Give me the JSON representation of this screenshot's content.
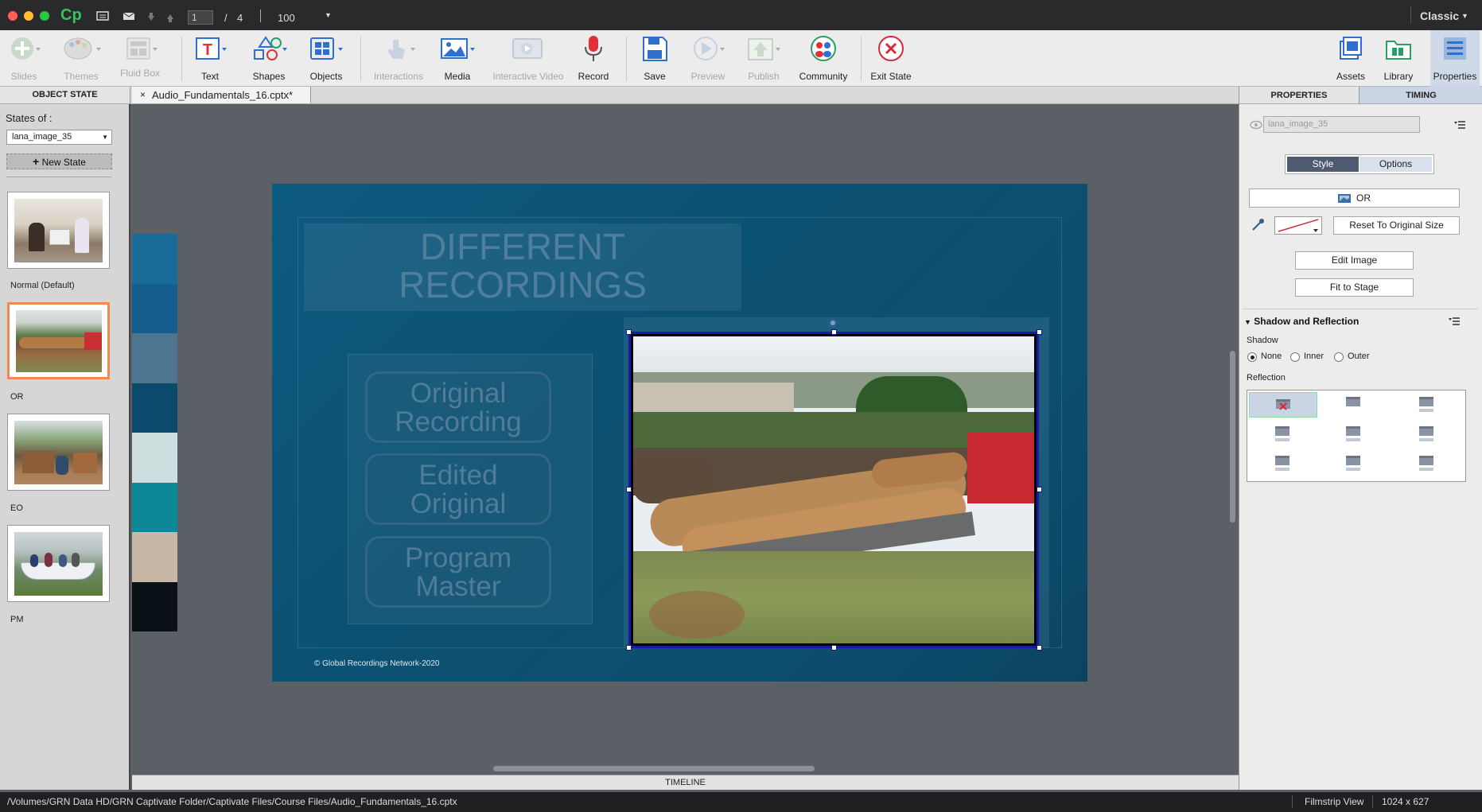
{
  "app": {
    "logo": "Cp",
    "page_current": "1",
    "page_sep": "/",
    "page_total": "4",
    "zoom": "100",
    "workspace": "Classic"
  },
  "toolbar": {
    "slides": "Slides",
    "themes": "Themes",
    "fluid_box": "Fluid Box",
    "text": "Text",
    "shapes": "Shapes",
    "objects": "Objects",
    "interactions": "Interactions",
    "media": "Media",
    "interactive_video": "Interactive Video",
    "record": "Record",
    "save": "Save",
    "preview": "Preview",
    "publish": "Publish",
    "community": "Community",
    "exit_state": "Exit State",
    "assets": "Assets",
    "library": "Library",
    "properties": "Properties"
  },
  "tabs": {
    "object_state": "OBJECT STATE",
    "doc_close": "×",
    "doc": "Audio_Fundamentals_16.cptx*",
    "properties": "PROPERTIES",
    "timing": "TIMING"
  },
  "states": {
    "label": "States of :",
    "selected_object": "lana_image_35",
    "new_state": "New State",
    "items": [
      {
        "label": "Normal (Default)"
      },
      {
        "label": "OR"
      },
      {
        "label": "EO"
      },
      {
        "label": "PM"
      }
    ]
  },
  "slide": {
    "title_line1": "DIFFERENT",
    "title_line2": "RECORDINGS",
    "btn1_l1": "Original",
    "btn1_l2": "Recording",
    "btn2_l1": "Edited",
    "btn2_l2": "Original",
    "btn3_l1": "Program",
    "btn3_l2": "Master",
    "copyright": "© Global Recordings Network-2020"
  },
  "swatches": [
    "#1a6a9a",
    "#135e8e",
    "#4d7590",
    "#0b4a6c",
    "#cfdedf",
    "#0e8898",
    "#c7b8a6",
    "#0a1218"
  ],
  "props": {
    "name": "lana_image_35",
    "style_tab": "Style",
    "options_tab": "Options",
    "state_name": "OR",
    "reset_size": "Reset To Original Size",
    "edit_image": "Edit Image",
    "fit_stage": "Fit to Stage",
    "shadow_reflection": "Shadow and Reflection",
    "shadow": "Shadow",
    "shadow_none": "None",
    "shadow_inner": "Inner",
    "shadow_outer": "Outer",
    "reflection": "Reflection",
    "shadow_selected": "None"
  },
  "timeline": "TIMELINE",
  "status": {
    "path": "/Volumes/GRN Data HD/GRN Captivate Folder/Captivate Files/Course Files/Audio_Fundamentals_16.cptx",
    "view": "Filmstrip View",
    "size": "1024 x 627"
  },
  "colors": {
    "accent": "#2e7bd6",
    "selected_thumb": "#f28a50",
    "record_red": "#e0303a",
    "exit_red": "#d8283a",
    "shapes_blue": "#2f6fd0",
    "toolbar_bg": "#ececec",
    "slide_bg": "#0d5275"
  },
  "icons": [
    "add-slide-icon",
    "themes-icon",
    "fluid-box-icon",
    "text-icon",
    "shapes-icon",
    "objects-icon",
    "interactions-icon",
    "media-icon",
    "interactive-video-icon",
    "record-icon",
    "save-icon",
    "preview-icon",
    "publish-icon",
    "community-icon",
    "exit-state-icon",
    "assets-icon",
    "library-icon",
    "properties-icon"
  ]
}
